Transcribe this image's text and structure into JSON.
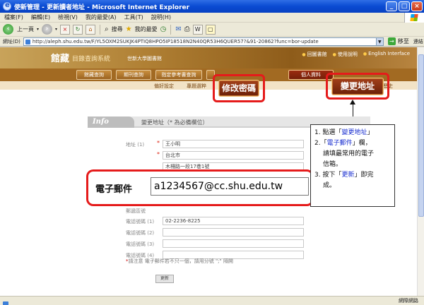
{
  "window": {
    "title": "使新管理 - 更新讀者地址 - Microsoft Internet Explorer",
    "minimize": "_",
    "maximize": "□",
    "close": "×"
  },
  "menu": [
    "檔案(F)",
    "編輯(E)",
    "檢視(V)",
    "我的最愛(A)",
    "工具(T)",
    "說明(H)"
  ],
  "toolbar": {
    "back_label": "上一頁",
    "search_label": "搜尋",
    "favorites_label": "我的最愛"
  },
  "address": {
    "label": "網址(D)",
    "url": "http://aleph.shu.edu.tw/F/YL5OXM2SUKJK4PTIQ8HPO5IP18518N2N40QR53H6QUER57?&91-20862?func=bor-update",
    "go_label": "移至",
    "links_label": "連結"
  },
  "site": {
    "logo": "館藏",
    "system_name": "目錄查詢系統",
    "university": "世新大學圖書館",
    "header_links": [
      "回圖書館",
      "使用說明",
      "English Interface"
    ],
    "tabs": [
      "館藏查詢",
      "期刊查詢",
      "指定參考書查詢",
      "",
      "",
      "個人資料"
    ],
    "subnav": [
      "偏好設定",
      "專題選粹",
      "",
      "我的查詢歷史"
    ]
  },
  "callouts": {
    "change_password": "修改密碼",
    "change_address": "變更地址"
  },
  "form": {
    "badge": "Info",
    "title": "變更地址（* 為必備欄位）",
    "address_label": "地址 (1)",
    "address_lines": [
      "王小明",
      "台北市",
      "木柵路一段17巷1號",
      "",
      ""
    ],
    "email_label": "電子郵件",
    "email_value": "a1234567@cc.shu.edu.tw",
    "zip_label": "郵遞區號",
    "phones": [
      {
        "label": "電話號碼 (1)",
        "value": "02-2236-8225"
      },
      {
        "label": "電話號碼 (2)",
        "value": ""
      },
      {
        "label": "電話號碼 (3)",
        "value": ""
      },
      {
        "label": "電話號碼 (4)",
        "value": ""
      }
    ],
    "note_star": "*",
    "note": "請注意 電子郵件若不只一個，請用分號 \";\" 隔開",
    "submit": "更新"
  },
  "instructions": {
    "step1_prefix": "1. 點選「",
    "step1_link": "變更地址",
    "step1_suffix": "」",
    "step2_prefix": "2.「",
    "step2_link": "電子郵件",
    "step2_suffix": "」欄，",
    "step2_line2": "請填最常用的電子",
    "step2_line3": "信箱。",
    "step3_prefix": "3. 按下「",
    "step3_link": "更新",
    "step3_suffix": "」即完",
    "step3_line2": "成。"
  },
  "status": {
    "left": "",
    "zone": "網際網路"
  }
}
